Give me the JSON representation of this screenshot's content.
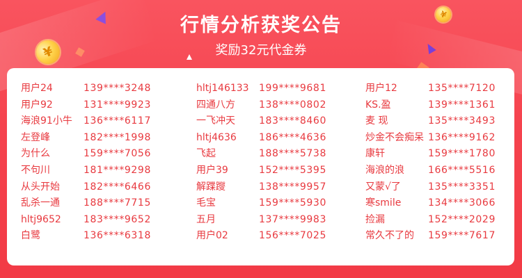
{
  "header": {
    "title": "行情分析获奖公告",
    "subtitle": "奖励32元代金券",
    "coin_symbol": "¥"
  },
  "winners": {
    "columns": [
      [
        {
          "name": "用户24",
          "phone": "139****3248"
        },
        {
          "name": "用户92",
          "phone": "131****9923"
        },
        {
          "name": "海浪91小牛",
          "phone": "136****6117"
        },
        {
          "name": "左登峰",
          "phone": "182****1998"
        },
        {
          "name": "为什么",
          "phone": "159****7056"
        },
        {
          "name": "不句川",
          "phone": "181****9298"
        },
        {
          "name": "从头开始",
          "phone": "182****6466"
        },
        {
          "name": "乱杀一通",
          "phone": "188****7715"
        },
        {
          "name": "hltj9652",
          "phone": "183****9652"
        },
        {
          "name": "白鹭",
          "phone": "136****6318"
        }
      ],
      [
        {
          "name": "hltj146133",
          "phone": "199****9681"
        },
        {
          "name": "四通八方",
          "phone": "138****0802"
        },
        {
          "name": "一飞冲天",
          "phone": "183****8460"
        },
        {
          "name": "hltj4636",
          "phone": "186****4636"
        },
        {
          "name": "飞起",
          "phone": "188****5738"
        },
        {
          "name": "用户39",
          "phone": "152****5395"
        },
        {
          "name": "解蹀躞",
          "phone": "138****9957"
        },
        {
          "name": "毛宝",
          "phone": "159****5930"
        },
        {
          "name": "五月",
          "phone": "137****9983"
        },
        {
          "name": "用户02",
          "phone": "156****7025"
        }
      ],
      [
        {
          "name": "用户12",
          "phone": "135****7120"
        },
        {
          "name": "KS.盈",
          "phone": "139****1361"
        },
        {
          "name": "麦 现",
          "phone": "135****3493"
        },
        {
          "name": "炒金不会痴呆",
          "phone": "136****9162"
        },
        {
          "name": "康轩",
          "phone": "159****1780"
        },
        {
          "name": "海浪的浪",
          "phone": "166****5516"
        },
        {
          "name": "又蒙√了",
          "phone": "135****3351"
        },
        {
          "name": "寒smile",
          "phone": "134****3066"
        },
        {
          "name": "捡漏",
          "phone": "152****2029"
        },
        {
          "name": "常久不了的",
          "phone": "159****7617"
        }
      ]
    ]
  },
  "colors": {
    "background": "#f5434e",
    "panel": "#ffffff",
    "text_red": "#e8393f",
    "coin_gold": "#ffd24a",
    "accent_purple": "#8a4fe0"
  }
}
